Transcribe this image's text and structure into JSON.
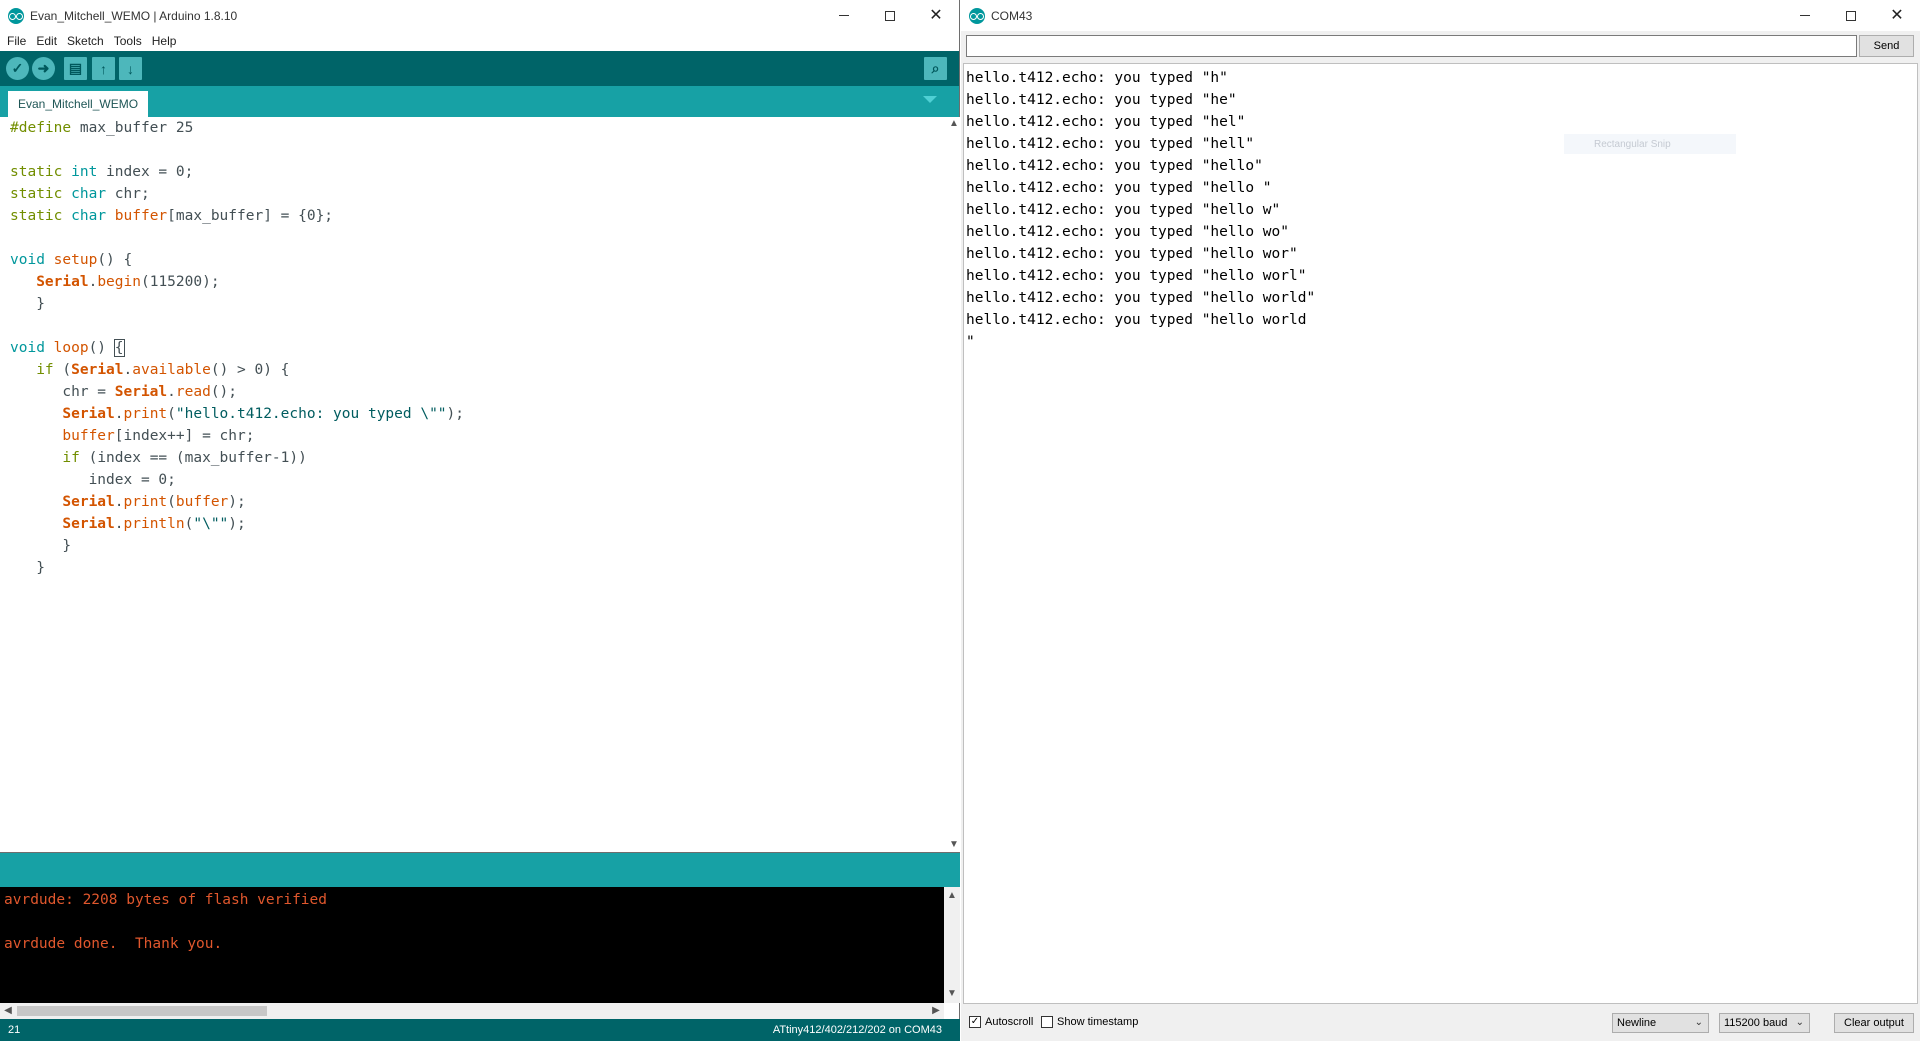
{
  "ide": {
    "title": "Evan_Mitchell_WEMO | Arduino 1.8.10",
    "menu": [
      "File",
      "Edit",
      "Sketch",
      "Tools",
      "Help"
    ],
    "toolbar": {
      "verify_icon": "checkmark-icon",
      "upload_icon": "right-arrow-icon",
      "new_icon": "new-file-icon",
      "open_icon": "up-arrow-icon",
      "save_icon": "down-arrow-icon",
      "serial_icon": "magnifier-icon"
    },
    "tab": "Evan_Mitchell_WEMO",
    "console_lines": [
      "avrdude: 2208 bytes of flash verified",
      "",
      "avrdude done.  Thank you."
    ],
    "status_line": "21",
    "status_board": "ATtiny412/402/212/202 on COM43",
    "colors": {
      "toolbar": "#006468",
      "tabbar": "#17a1a5",
      "console_text": "#e0572d"
    }
  },
  "serial": {
    "title": "COM43",
    "input_value": "",
    "send_label": "Send",
    "output_lines": [
      "hello.t412.echo: you typed \"h\"",
      "hello.t412.echo: you typed \"he\"",
      "hello.t412.echo: you typed \"hel\"",
      "hello.t412.echo: you typed \"hell\"",
      "hello.t412.echo: you typed \"hello\"",
      "hello.t412.echo: you typed \"hello \"",
      "hello.t412.echo: you typed \"hello w\"",
      "hello.t412.echo: you typed \"hello wo\"",
      "hello.t412.echo: you typed \"hello wor\"",
      "hello.t412.echo: you typed \"hello worl\"",
      "hello.t412.echo: you typed \"hello world\"",
      "hello.t412.echo: you typed \"hello world",
      "\""
    ],
    "snip_text": "Rectangular Snip",
    "autoscroll_label": "Autoscroll",
    "autoscroll_checked": true,
    "timestamp_label": "Show timestamp",
    "timestamp_checked": false,
    "line_ending": "Newline",
    "baud": "115200 baud",
    "clear_label": "Clear output"
  }
}
